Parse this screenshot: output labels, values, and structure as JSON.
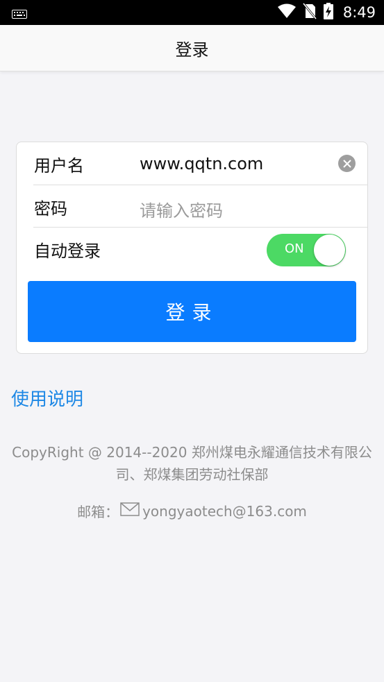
{
  "status_bar": {
    "time": "8:49",
    "icons": [
      "keyboard-icon",
      "wifi-icon",
      "no-sim-icon",
      "battery-charging-icon"
    ]
  },
  "nav": {
    "title": "登录"
  },
  "form": {
    "username_label": "用户名",
    "username_value": "www.qqtn.com",
    "password_label": "密码",
    "password_placeholder": "请输入密码",
    "auto_login_label": "自动登录",
    "auto_login_state": "ON",
    "login_button": "登录"
  },
  "help_link": "使用说明",
  "footer": {
    "copyright_line1": "CopyRight @ 2014--2020 郑州煤电永耀通信技术有限公",
    "copyright_line2": "司、郑煤集团劳动社保部",
    "email_label": "邮箱：",
    "email_value": "yongyaotech@163.com"
  },
  "colors": {
    "accent_blue": "#0a7cff",
    "toggle_green": "#4cd964",
    "link_blue": "#1e88e5",
    "background": "#f4f4f7"
  }
}
